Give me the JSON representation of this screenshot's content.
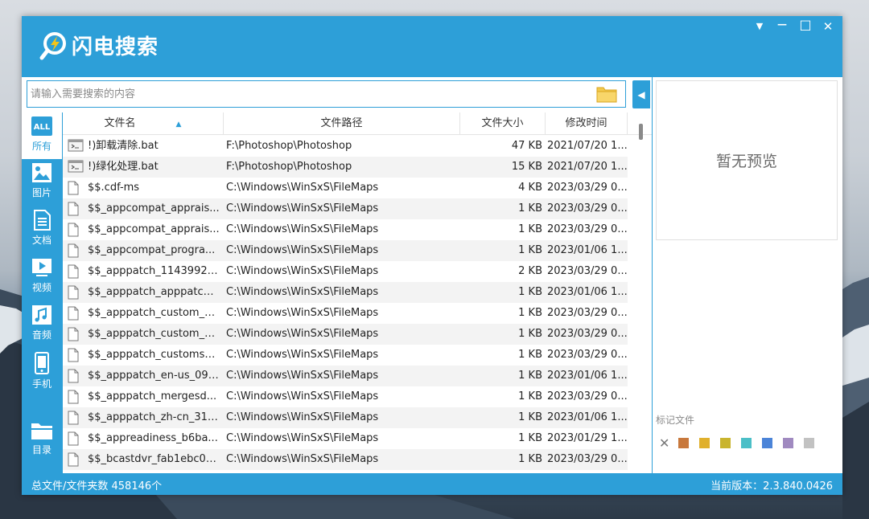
{
  "app": {
    "title": "闪电搜索"
  },
  "window_controls": {
    "menu": "▼",
    "minimize": "—",
    "maximize": "□",
    "close": "✕"
  },
  "search": {
    "placeholder": "请输入需要搜索的内容",
    "value": ""
  },
  "sidebar": {
    "items": [
      {
        "label": "所有",
        "icon": "all-icon",
        "active": true
      },
      {
        "label": "图片",
        "icon": "image-icon",
        "active": false
      },
      {
        "label": "文档",
        "icon": "document-icon",
        "active": false
      },
      {
        "label": "视频",
        "icon": "video-icon",
        "active": false
      },
      {
        "label": "音频",
        "icon": "audio-icon",
        "active": false
      },
      {
        "label": "手机",
        "icon": "phone-icon",
        "active": false
      },
      {
        "label": "目录",
        "icon": "folder-icon",
        "active": false
      }
    ]
  },
  "table": {
    "columns": [
      "文件名",
      "文件路径",
      "文件大小",
      "修改时间"
    ],
    "sort_indicator": "▲",
    "rows": [
      {
        "name": "!)卸载清除.bat",
        "path": "F:\\Photoshop\\Photoshop",
        "size": "47 KB",
        "modified": "2021/07/20 1...",
        "icon": "bat-file-icon"
      },
      {
        "name": "!)绿化处理.bat",
        "path": "F:\\Photoshop\\Photoshop",
        "size": "15 KB",
        "modified": "2021/07/20 1...",
        "icon": "bat-file-icon"
      },
      {
        "name": "$$.cdf-ms",
        "path": "C:\\Windows\\WinSxS\\FileMaps",
        "size": "4 KB",
        "modified": "2023/03/29 0...",
        "icon": "file-icon"
      },
      {
        "name": "$$_appcompat_apprais...",
        "path": "C:\\Windows\\WinSxS\\FileMaps",
        "size": "1 KB",
        "modified": "2023/03/29 0...",
        "icon": "file-icon"
      },
      {
        "name": "$$_appcompat_apprais...",
        "path": "C:\\Windows\\WinSxS\\FileMaps",
        "size": "1 KB",
        "modified": "2023/03/29 0...",
        "icon": "file-icon"
      },
      {
        "name": "$$_appcompat_progra...",
        "path": "C:\\Windows\\WinSxS\\FileMaps",
        "size": "1 KB",
        "modified": "2023/01/06 1...",
        "icon": "file-icon"
      },
      {
        "name": "$$_apppatch_1143992c...",
        "path": "C:\\Windows\\WinSxS\\FileMaps",
        "size": "2 KB",
        "modified": "2023/03/29 0...",
        "icon": "file-icon"
      },
      {
        "name": "$$_apppatch_apppatch...",
        "path": "C:\\Windows\\WinSxS\\FileMaps",
        "size": "1 KB",
        "modified": "2023/01/06 1...",
        "icon": "file-icon"
      },
      {
        "name": "$$_apppatch_custom_2...",
        "path": "C:\\Windows\\WinSxS\\FileMaps",
        "size": "1 KB",
        "modified": "2023/03/29 0...",
        "icon": "file-icon"
      },
      {
        "name": "$$_apppatch_custom_c...",
        "path": "C:\\Windows\\WinSxS\\FileMaps",
        "size": "1 KB",
        "modified": "2023/03/29 0...",
        "icon": "file-icon"
      },
      {
        "name": "$$_apppatch_customsd...",
        "path": "C:\\Windows\\WinSxS\\FileMaps",
        "size": "1 KB",
        "modified": "2023/03/29 0...",
        "icon": "file-icon"
      },
      {
        "name": "$$_apppatch_en-us_098...",
        "path": "C:\\Windows\\WinSxS\\FileMaps",
        "size": "1 KB",
        "modified": "2023/01/06 1...",
        "icon": "file-icon"
      },
      {
        "name": "$$_apppatch_mergesd...",
        "path": "C:\\Windows\\WinSxS\\FileMaps",
        "size": "1 KB",
        "modified": "2023/03/29 0...",
        "icon": "file-icon"
      },
      {
        "name": "$$_apppatch_zh-cn_317...",
        "path": "C:\\Windows\\WinSxS\\FileMaps",
        "size": "1 KB",
        "modified": "2023/01/06 1...",
        "icon": "file-icon"
      },
      {
        "name": "$$_appreadiness_b6ba...",
        "path": "C:\\Windows\\WinSxS\\FileMaps",
        "size": "1 KB",
        "modified": "2023/01/29 1...",
        "icon": "file-icon"
      },
      {
        "name": "$$_bcastdvr_fab1ebc0d...",
        "path": "C:\\Windows\\WinSxS\\FileMaps",
        "size": "1 KB",
        "modified": "2023/03/29 0...",
        "icon": "file-icon"
      }
    ]
  },
  "preview": {
    "empty_text": "暂无预览"
  },
  "marks": {
    "title": "标记文件",
    "clear": "✕",
    "colors": [
      "#c8783c",
      "#e0b02c",
      "#c9b42e",
      "#4bbfc7",
      "#4b84d8",
      "#a08ac0",
      "#c2c2c2"
    ]
  },
  "status": {
    "left": "总文件/文件夹数 458146个",
    "right": "当前版本：2.3.840.0426"
  },
  "theme": {
    "accent": "#2d9fd8"
  }
}
